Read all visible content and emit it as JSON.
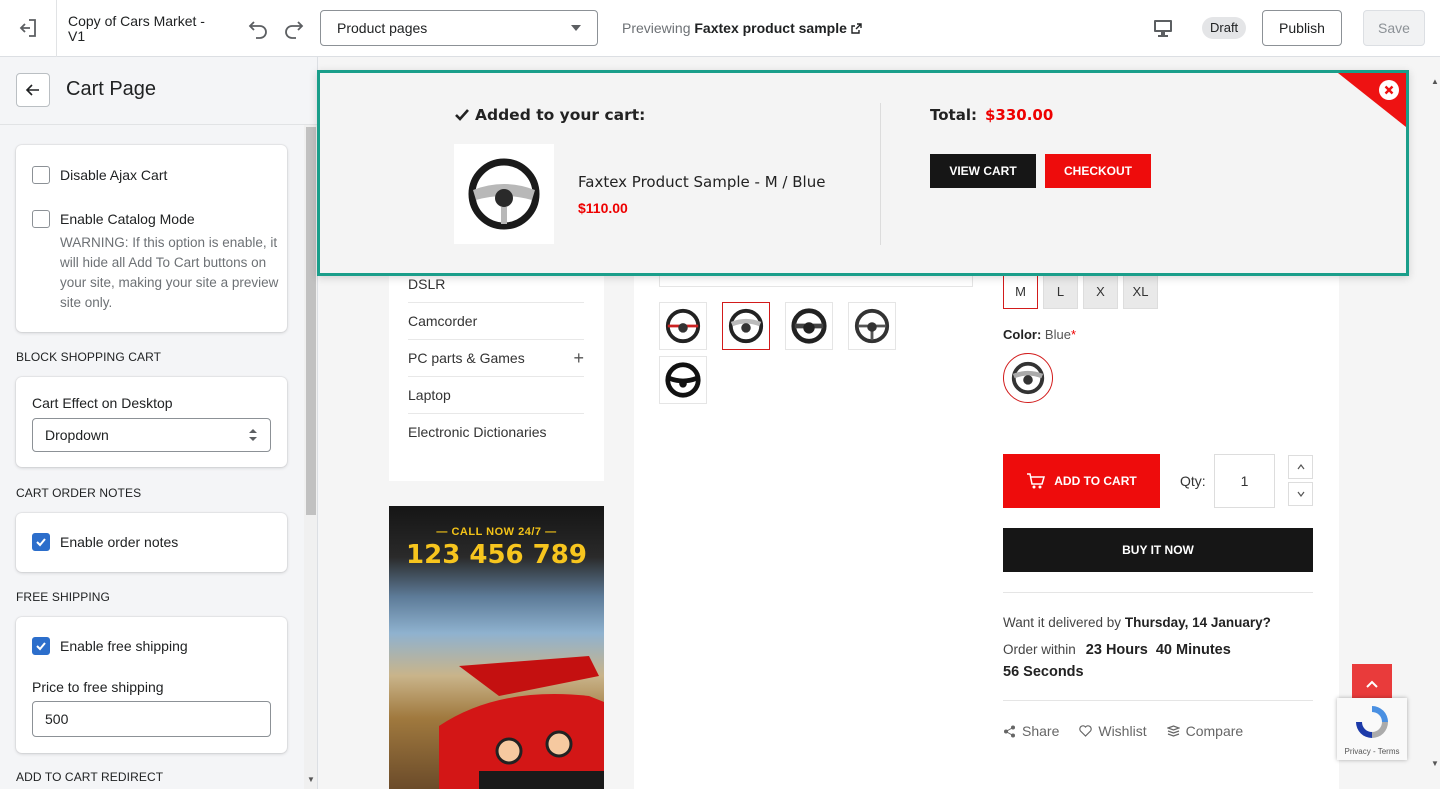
{
  "topbar": {
    "theme_name": "Copy of Cars Market - V1",
    "page_select_value": "Product pages",
    "preview_prefix": "Previewing",
    "preview_product": "Faxtex product sample",
    "status_badge": "Draft",
    "publish_label": "Publish",
    "save_label": "Save"
  },
  "sidebar": {
    "title": "Cart Page",
    "disable_ajax_cart": {
      "label": "Disable Ajax Cart",
      "checked": false
    },
    "catalog_mode": {
      "label": "Enable Catalog Mode",
      "checked": false,
      "warning": "WARNING: If this option is enable, it will hide all Add To Cart buttons on your site, making your site a preview site only."
    },
    "block_shopping_cart": {
      "heading": "BLOCK SHOPPING CART",
      "effect_label": "Cart Effect on Desktop",
      "effect_value": "Dropdown"
    },
    "cart_order_notes": {
      "heading": "CART ORDER NOTES",
      "label": "Enable order notes",
      "checked": true
    },
    "free_shipping": {
      "heading": "FREE SHIPPING",
      "label": "Enable free shipping",
      "checked": true,
      "price_label": "Price to free shipping",
      "price_value": "500"
    },
    "add_to_cart_redirect": {
      "heading": "ADD TO CART REDIRECT"
    }
  },
  "preview": {
    "menu_items": [
      "DSLR",
      "Camcorder",
      "PC parts & Games",
      "Laptop",
      "Electronic Dictionaries"
    ],
    "banner": {
      "call_text": "CALL NOW 24/7",
      "phone": "123 456 789"
    },
    "sizes": [
      "M",
      "L",
      "X",
      "XL"
    ],
    "selected_size": "M",
    "color_label": "Color:",
    "color_value": "Blue",
    "color_required": "*",
    "add_to_cart_label": "ADD TO CART",
    "qty_label": "Qty:",
    "qty_value": "1",
    "buy_now_label": "BUY IT NOW",
    "delivery_prefix": "Want it delivered by",
    "delivery_date": "Thursday, 14 January?",
    "order_within_prefix": "Order within",
    "countdown_hours": "23 Hours",
    "countdown_minutes": "40 Minutes",
    "countdown_seconds": "56 Seconds",
    "share_label": "Share",
    "wishlist_label": "Wishlist",
    "compare_label": "Compare",
    "recaptcha_text": "Privacy - Terms"
  },
  "cart_popup": {
    "added_label": "Added to your cart:",
    "product_name": "Faxtex Product Sample - M / Blue",
    "product_price": "$110.00",
    "total_label": "Total:",
    "total_value": "$330.00",
    "view_cart_label": "VIEW CART",
    "checkout_label": "CHECKOUT"
  },
  "colors": {
    "accent_red": "#ee0c0c",
    "popup_border": "#1a9e8a",
    "checkbox_blue": "#2c6ecb",
    "dark_button": "#161616"
  },
  "icons": [
    "exit-icon",
    "undo-icon",
    "redo-icon",
    "chevron-down-icon",
    "external-link-icon",
    "monitor-icon",
    "back-arrow-icon",
    "check-icon",
    "plus-icon",
    "cart-icon",
    "share-icon",
    "heart-icon",
    "compare-icon",
    "close-icon",
    "chevron-up-icon"
  ]
}
